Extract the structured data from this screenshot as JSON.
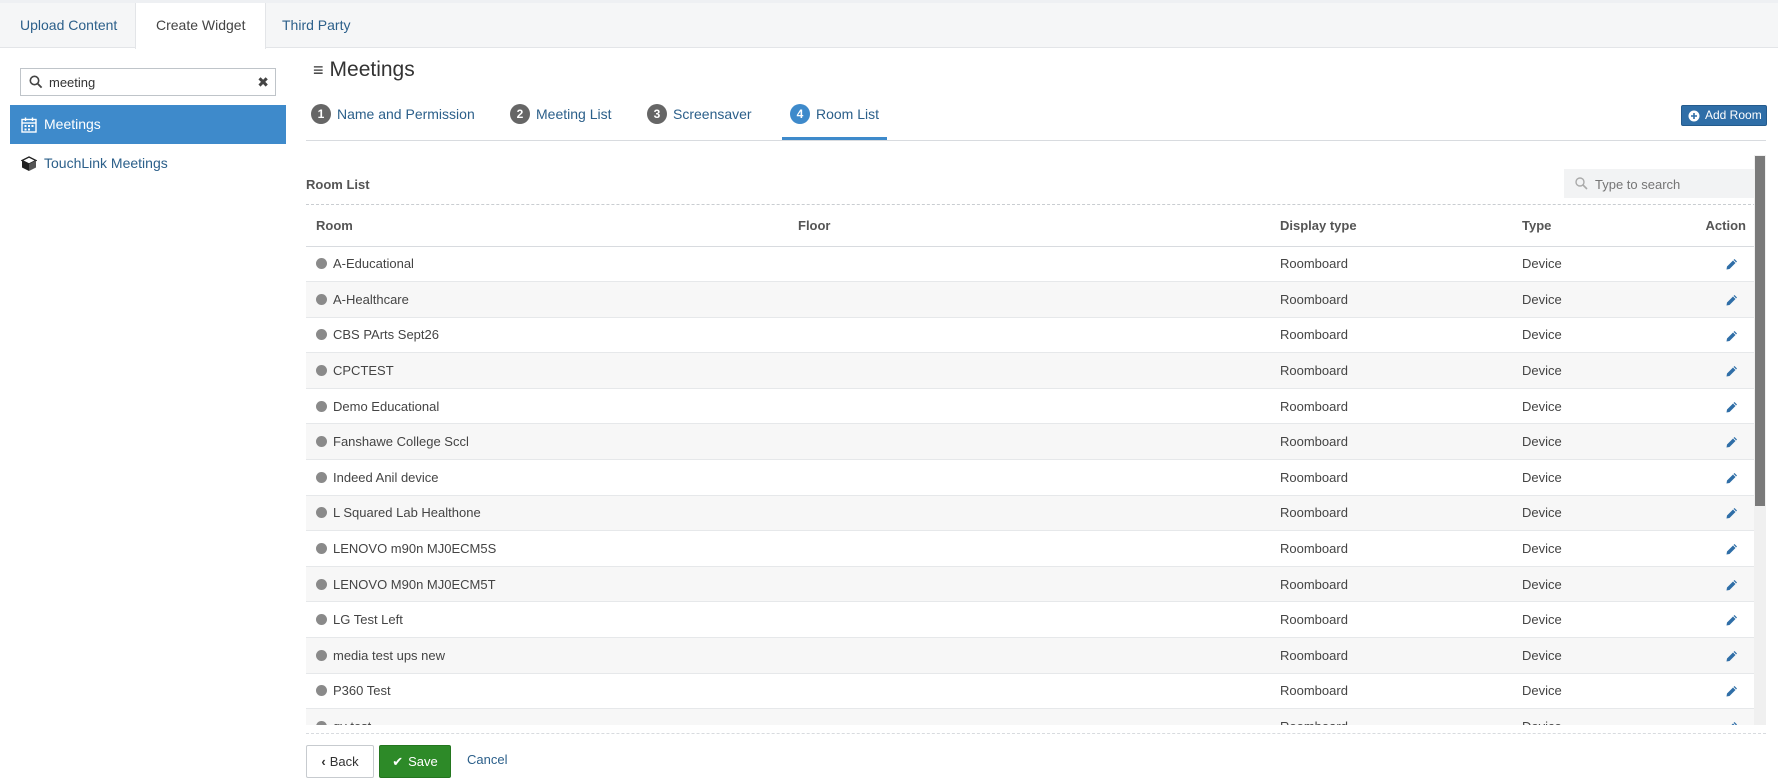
{
  "top_tabs": [
    {
      "label": "Upload Content"
    },
    {
      "label": "Create Widget"
    },
    {
      "label": "Third Party"
    }
  ],
  "sidebar": {
    "search_value": "meeting",
    "items": [
      {
        "label": "Meetings",
        "icon": "calendar-icon"
      },
      {
        "label": "TouchLink Meetings",
        "icon": "cube-icon"
      }
    ]
  },
  "page": {
    "title": "Meetings",
    "steps": [
      {
        "num": "1",
        "label": "Name and Permission"
      },
      {
        "num": "2",
        "label": "Meeting List"
      },
      {
        "num": "3",
        "label": "Screensaver"
      },
      {
        "num": "4",
        "label": "Room List"
      }
    ],
    "add_room_label": "Add Room"
  },
  "room_list": {
    "title": "Room List",
    "search_placeholder": "Type to search",
    "columns": [
      "Room",
      "Floor",
      "Display type",
      "Type",
      "Action"
    ],
    "rows": [
      {
        "room": "A-Educational",
        "floor": "",
        "display_type": "Roomboard",
        "type": "Device"
      },
      {
        "room": "A-Healthcare",
        "floor": "",
        "display_type": "Roomboard",
        "type": "Device"
      },
      {
        "room": "CBS PArts Sept26",
        "floor": "",
        "display_type": "Roomboard",
        "type": "Device"
      },
      {
        "room": "CPCTEST",
        "floor": "",
        "display_type": "Roomboard",
        "type": "Device"
      },
      {
        "room": "Demo Educational",
        "floor": "",
        "display_type": "Roomboard",
        "type": "Device"
      },
      {
        "room": "Fanshawe College Sccl",
        "floor": "",
        "display_type": "Roomboard",
        "type": "Device"
      },
      {
        "room": "Indeed Anil device",
        "floor": "",
        "display_type": "Roomboard",
        "type": "Device"
      },
      {
        "room": "L Squared Lab Healthone",
        "floor": "",
        "display_type": "Roomboard",
        "type": "Device"
      },
      {
        "room": "LENOVO m90n MJ0ECM5S",
        "floor": "",
        "display_type": "Roomboard",
        "type": "Device"
      },
      {
        "room": "LENOVO M90n MJ0ECM5T",
        "floor": "",
        "display_type": "Roomboard",
        "type": "Device"
      },
      {
        "room": "LG Test Left",
        "floor": "",
        "display_type": "Roomboard",
        "type": "Device"
      },
      {
        "room": "media test ups new",
        "floor": "",
        "display_type": "Roomboard",
        "type": "Device"
      },
      {
        "room": "P360 Test",
        "floor": "",
        "display_type": "Roomboard",
        "type": "Device"
      },
      {
        "room": "qy test",
        "floor": "",
        "display_type": "Roomboard",
        "type": "Device"
      }
    ]
  },
  "footer": {
    "back_label": "Back",
    "save_label": "Save",
    "cancel_label": "Cancel"
  },
  "colors": {
    "accent": "#3e8acb",
    "save_green": "#2d8a28",
    "link_blue": "#2b5f8a"
  }
}
